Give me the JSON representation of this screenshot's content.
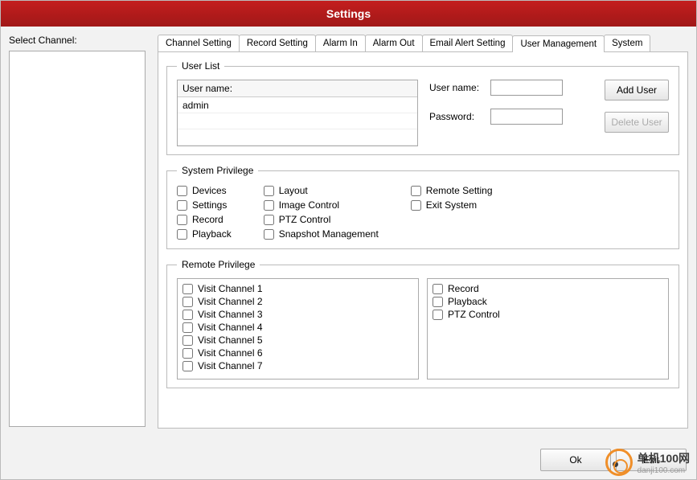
{
  "title": "Settings",
  "selectChannelLabel": "Select Channel:",
  "tabs": [
    "Channel Setting",
    "Record Setting",
    "Alarm In",
    "Alarm Out",
    "Email Alert Setting",
    "User Management",
    "System"
  ],
  "activeTabIndex": 5,
  "userList": {
    "legend": "User List",
    "colHeader": "User name:",
    "rows": [
      "admin",
      "",
      ""
    ],
    "userNameLabel": "User name:",
    "userNameValue": "",
    "passwordLabel": "Password:",
    "passwordValue": "",
    "addBtn": "Add User",
    "deleteBtn": "Delete User"
  },
  "systemPrivilege": {
    "legend": "System Privilege",
    "col1": [
      "Devices",
      "Settings",
      "Record",
      "Playback"
    ],
    "col2": [
      "Layout",
      "Image Control",
      "PTZ Control",
      "Snapshot Management"
    ],
    "col3": [
      "Remote Setting",
      "Exit System"
    ]
  },
  "remotePrivilege": {
    "legend": "Remote Privilege",
    "left": [
      "Visit Channel 1",
      "Visit Channel 2",
      "Visit Channel 3",
      "Visit Channel 4",
      "Visit Channel 5",
      "Visit Channel 6",
      "Visit Channel 7"
    ],
    "right": [
      "Record",
      "Playback",
      "PTZ Control"
    ]
  },
  "okBtn": "Ok",
  "exitBtn": "Exit",
  "watermark": {
    "cn": "单机100网",
    "url": "danji100.com"
  }
}
